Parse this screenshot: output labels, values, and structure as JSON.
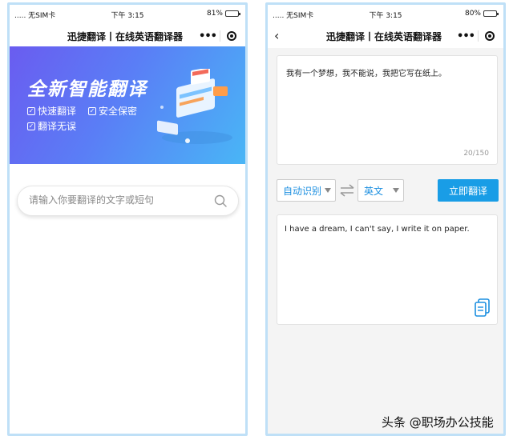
{
  "left": {
    "status": {
      "carrier": "..... 无SIM卡",
      "time": "下午 3:15",
      "battery": "81%",
      "battery_level": 0.81
    },
    "nav": {
      "title": "迅捷翻译丨在线英语翻译器",
      "more": "•••"
    },
    "banner": {
      "headline": "全新智能翻译",
      "features": [
        "快速翻译",
        "安全保密",
        "翻译无误"
      ]
    },
    "search": {
      "placeholder": "请输入你要翻译的文字或短句"
    }
  },
  "right": {
    "status": {
      "carrier": "..... 无SIM卡",
      "time": "下午 3:15",
      "battery": "80%",
      "battery_level": 0.8
    },
    "nav": {
      "title": "迅捷翻译丨在线英语翻译器",
      "more": "•••"
    },
    "source": {
      "text": "我有一个梦想，我不能说，我把它写在纸上。",
      "counter": "20/150"
    },
    "controls": {
      "from": "自动识别",
      "to": "英文",
      "translate_label": "立即翻译"
    },
    "result": {
      "text": "I have a dream, I can't say, I write it on paper."
    }
  },
  "watermark": "头条 @职场办公技能",
  "colors": {
    "accent": "#199de6",
    "banner_start": "#6a5cf0",
    "banner_end": "#49b6f6"
  }
}
